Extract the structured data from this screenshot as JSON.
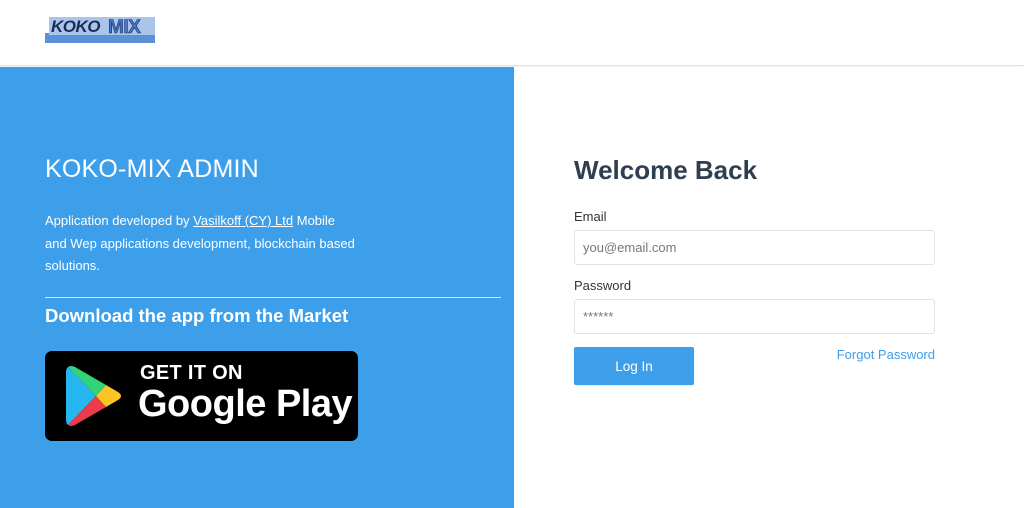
{
  "header": {
    "logo_text": "KOKOMIX"
  },
  "left": {
    "title": "KOKO-MIX ADMIN",
    "description_prefix": "Application developed by ",
    "company_link": "Vasilkoff (CY) Ltd",
    "description_suffix": " Mobile and Wep applications development, blockchain based solutions.",
    "market_title": "Download the app from the Market",
    "badge": {
      "top_text": "GET IT ON",
      "bottom_text": "Google Play",
      "icon": "google-play-icon"
    }
  },
  "login": {
    "title": "Welcome Back",
    "email_label": "Email",
    "email_placeholder": "you@email.com",
    "password_label": "Password",
    "password_placeholder": "******",
    "login_button": "Log In",
    "forgot_link": "Forgot Password"
  },
  "colors": {
    "accent": "#3d9fea",
    "heading": "#2f3e50",
    "badge_bg": "#000000"
  }
}
